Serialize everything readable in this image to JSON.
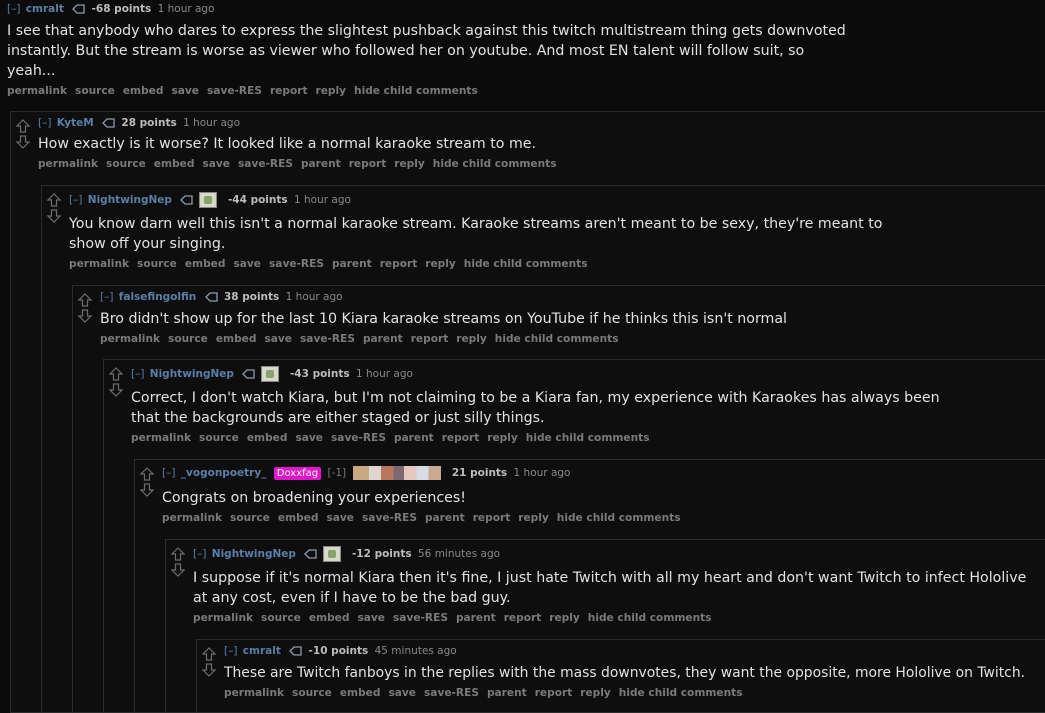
{
  "buttons": [
    "permalink",
    "source",
    "embed",
    "save",
    "save-RES",
    "report",
    "reply",
    "hide child comments"
  ],
  "buttons_with_parent": [
    "permalink",
    "source",
    "embed",
    "save",
    "save-RES",
    "parent",
    "report",
    "reply",
    "hide child comments"
  ],
  "collapse": "[–]",
  "comments": [
    {
      "author": "cmralt",
      "score": "-68 points",
      "time": "1 hour ago",
      "body": "I see that anybody who dares to express the slightest pushback against this twitch multistream thing gets downvoted instantly. But the stream is worse as viewer who followed her on youtube. And most EN talent will follow suit, so yeah..."
    },
    {
      "author": "KyteM",
      "score": "28 points",
      "time": "1 hour ago",
      "body": "How exactly is it worse? It looked like a normal karaoke stream to me."
    },
    {
      "author": "NightwingNep",
      "score": "-44 points",
      "time": "1 hour ago",
      "body": "You know darn well this isn't a normal karaoke stream. Karaoke streams aren't meant to be sexy, they're meant to show off your singing."
    },
    {
      "author": "falsefingolfin",
      "score": "38 points",
      "time": "1 hour ago",
      "body": "Bro didn't show up for the last 10 Kiara karaoke streams on YouTube if he thinks this isn't normal"
    },
    {
      "author": "NightwingNep",
      "score": "-43 points",
      "time": "1 hour ago",
      "body": "Correct, I don't watch Kiara, but I'm not claiming to be a Kiara fan, my experience with Karaokes has always been that the backgrounds are either staged or just silly things."
    },
    {
      "author": "_vogonpoetry_",
      "badge": "Doxxfag",
      "bracket": "[-1]",
      "score": "21 points",
      "time": "1 hour ago",
      "body": "Congrats on broadening your experiences!"
    },
    {
      "author": "NightwingNep",
      "score": "-12 points",
      "time": "56 minutes ago",
      "body": "I suppose if it's normal Kiara then it's fine, I just hate Twitch with all my heart and don't want Twitch to infect Hololive at any cost, even if I have to be the bad guy."
    },
    {
      "author": "cmralt",
      "score": "-10 points",
      "time": "45 minutes ago",
      "body": "These are Twitch fanboys in the replies with the mass downvotes, they want the opposite, more Hololive on Twitch."
    }
  ]
}
